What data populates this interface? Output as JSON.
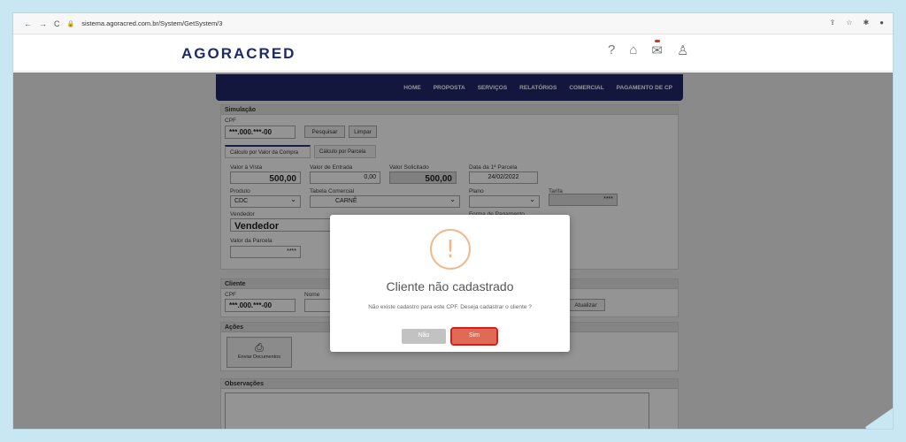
{
  "browser": {
    "url": "sistema.agoracred.com.br/System/GetSystem/3",
    "nav_back": "←",
    "nav_forward": "→",
    "reload": "C"
  },
  "site": {
    "logo": "AGORACRED",
    "nav": [
      "HOME",
      "PROPOSTA",
      "SERVIÇOS",
      "RELATÓRIOS",
      "COMERCIAL",
      "PAGAMENTO DE CP"
    ]
  },
  "simulacao": {
    "title": "Simulação",
    "cpf_label": "CPF",
    "cpf_value": "***.000.***-00",
    "pesquisar": "Pesquisar",
    "limpar": "Limpar",
    "tabs": [
      "Cálculo por Valor da Compra",
      "Cálculo por Parcela"
    ],
    "valor_vista_label": "Valor à Vista",
    "valor_vista": "500,00",
    "valor_entrada_label": "Valor de Entrada",
    "valor_entrada": "0,00",
    "valor_solicitado_label": "Valor Solicitado",
    "valor_solicitado": "500,00",
    "data_parcela_label": "Data da 1ª Parcela",
    "data_parcela": "24/02/2022",
    "produto_label": "Produto",
    "produto": "CDC",
    "tabela_label": "Tabela Comercial",
    "tabela": "CARNÊ",
    "plano_label": "Plano",
    "tarifa_label": "Tarifa",
    "tarifa": "****",
    "vendedor_label": "Vendedor",
    "vendedor": "Vendedor",
    "forma_pagamento_label": "Forma de Pagamento",
    "valor_parcela_label": "Valor da Parcela",
    "valor_parcela": "****"
  },
  "cliente": {
    "title": "Cliente",
    "cpf_label": "CPF",
    "cpf_value": "***.000.***-00",
    "nome_label": "Nome",
    "atualizar": "Atualizar"
  },
  "acoes": {
    "title": "Ações",
    "enviar": "Enviar Documentos"
  },
  "observacoes": {
    "title": "Observações"
  },
  "modal": {
    "icon": "!",
    "title": "Cliente não cadastrado",
    "text": "Não existe cadastro para este CPF. Deseja cadastrar o cliente ?",
    "no": "Não",
    "yes": "Sim"
  },
  "colors": {
    "nav_bg": "#23296a",
    "confirm": "#dd6b55",
    "highlight": "#e01818",
    "warning": "#f0b98a"
  }
}
